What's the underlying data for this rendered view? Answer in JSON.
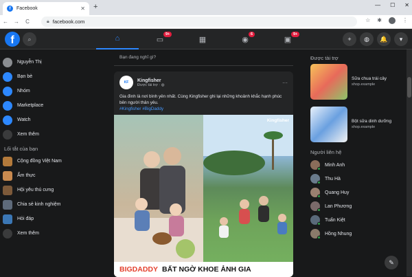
{
  "browser": {
    "tab_title": "Facebook",
    "new_tab": "+",
    "minimize": "—",
    "maximize": "☐",
    "close": "✕",
    "back": "←",
    "forward": "→",
    "reload": "C",
    "url": "facebook.com"
  },
  "fb": {
    "logo_letter": "f",
    "nav": [
      {
        "icon": "home-icon",
        "glyph": "⌂"
      },
      {
        "icon": "watch-icon",
        "glyph": "▭",
        "badge": "9+"
      },
      {
        "icon": "marketplace-icon",
        "glyph": "▦"
      },
      {
        "icon": "groups-icon",
        "glyph": "◉",
        "badge": "6"
      },
      {
        "icon": "gaming-icon",
        "glyph": "▣",
        "badge": "9+"
      }
    ],
    "right_buttons": [
      "+",
      "◍",
      "🔔",
      "▾"
    ]
  },
  "left": {
    "items": [
      {
        "label": "Nguyễn Thị",
        "color": "#8a8d91"
      },
      {
        "label": "Bạn bè",
        "color": "#2d88ff"
      },
      {
        "label": "Nhóm",
        "color": "#2d88ff"
      },
      {
        "label": "Marketplace",
        "color": "#2d88ff"
      },
      {
        "label": "Watch",
        "color": "#2d88ff"
      },
      {
        "label": "Xem thêm",
        "color": "#3a3b3c"
      }
    ],
    "section": "Lối tắt của bạn",
    "shortcuts": [
      {
        "label": "Cộng đồng Việt Nam",
        "color": "#b37a3b"
      },
      {
        "label": "Ẩm thực",
        "color": "#c98a4f"
      },
      {
        "label": "Hội yêu thú cưng",
        "color": "#7d5a3a"
      },
      {
        "label": "Chia sẻ kinh nghiệm",
        "color": "#5e6a7a"
      },
      {
        "label": "Hỏi đáp",
        "color": "#3b77b5"
      },
      {
        "label": "Xem thêm",
        "color": "#3a3b3c"
      }
    ]
  },
  "feed": {
    "create_prompt": "Bạn đang nghĩ gì?",
    "post": {
      "page_name": "Kingfisher",
      "meta": "Được tài trợ · ◍",
      "text": "Gia đình là nơi bình yên nhất. Cùng Kingfisher ghi lại những khoảnh khắc hạnh phúc bên người thân yêu.",
      "hashtags": "#Kingfisher #BigDaddy",
      "image_tag": "Kingfisher",
      "caption_red": "BIGDADDY",
      "caption_black": "BẤT NGỜ KHOE ẢNH GIA"
    }
  },
  "right": {
    "sponsored": "Được tài trợ",
    "ads": [
      {
        "title": "Sữa chua trái cây",
        "sub": "shop.example"
      },
      {
        "title": "Bột sữa dinh dưỡng",
        "sub": "shop.example"
      }
    ],
    "contacts_title": "Người liên hệ",
    "contacts": [
      {
        "name": "Minh Anh",
        "color": "#8a6d5a"
      },
      {
        "name": "Thu Hà",
        "color": "#6a7b8c"
      },
      {
        "name": "Quang Huy",
        "color": "#9a8070"
      },
      {
        "name": "Lan Phương",
        "color": "#7a6a6a"
      },
      {
        "name": "Tuấn Kiệt",
        "color": "#5a6a7a"
      },
      {
        "name": "Hồng Nhung",
        "color": "#8a7a6a"
      }
    ]
  }
}
